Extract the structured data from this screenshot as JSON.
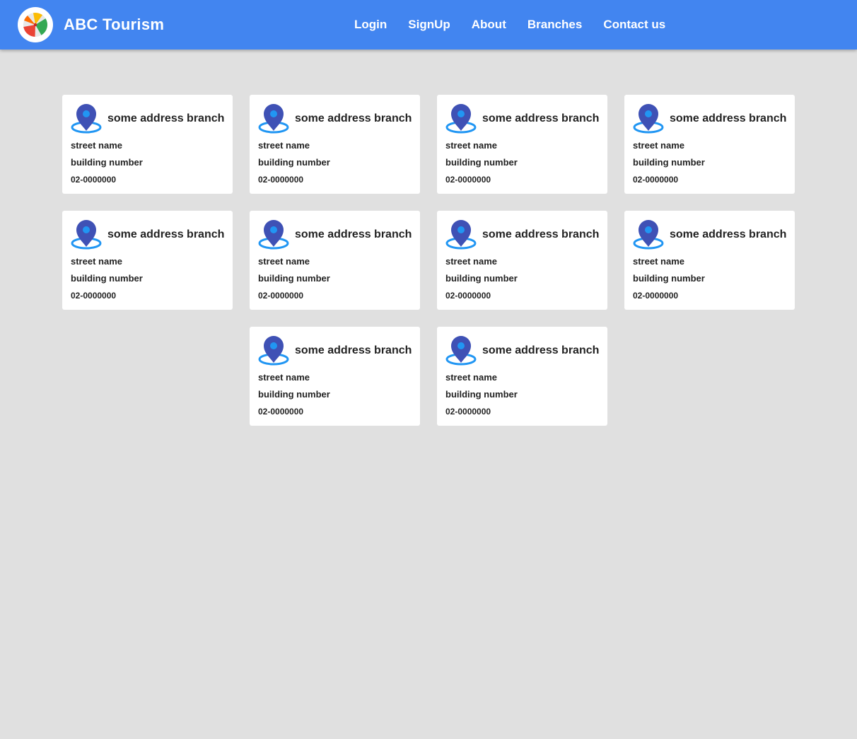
{
  "app": {
    "title": "ABC Tourism"
  },
  "nav": {
    "items": [
      {
        "label": "Login"
      },
      {
        "label": "SignUp"
      },
      {
        "label": "About"
      },
      {
        "label": "Branches"
      },
      {
        "label": "Contact us"
      }
    ]
  },
  "branches": [
    {
      "name": "some address branch",
      "street": "street name",
      "building": "building number",
      "phone": "02-0000000"
    },
    {
      "name": "some address branch",
      "street": "street name",
      "building": "building number",
      "phone": "02-0000000"
    },
    {
      "name": "some address branch",
      "street": "street name",
      "building": "building number",
      "phone": "02-0000000"
    },
    {
      "name": "some address branch",
      "street": "street name",
      "building": "building number",
      "phone": "02-0000000"
    },
    {
      "name": "some address branch",
      "street": "street name",
      "building": "building number",
      "phone": "02-0000000"
    },
    {
      "name": "some address branch",
      "street": "street name",
      "building": "building number",
      "phone": "02-0000000"
    },
    {
      "name": "some address branch",
      "street": "street name",
      "building": "building number",
      "phone": "02-0000000"
    },
    {
      "name": "some address branch",
      "street": "street name",
      "building": "building number",
      "phone": "02-0000000"
    },
    {
      "name": "some address branch",
      "street": "street name",
      "building": "building number",
      "phone": "02-0000000"
    },
    {
      "name": "some address branch",
      "street": "street name",
      "building": "building number",
      "phone": "02-0000000"
    }
  ],
  "icons": {
    "logo": "beach-ball-icon",
    "branch": "location-pin-icon"
  },
  "colors": {
    "navbar": "#4285f0",
    "background": "#e0e0e0",
    "pin": "#3f51b5",
    "pin_ring": "#2196f3"
  }
}
